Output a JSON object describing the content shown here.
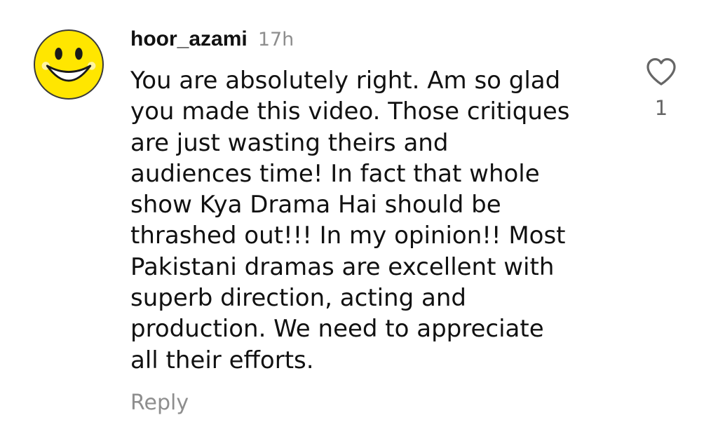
{
  "comment": {
    "username": "hoor_azami",
    "timestamp": "17h",
    "text_lines": [
      "You are absolutely right. Am so glad",
      "you made this video. Those critiques",
      "are just wasting theirs and",
      "audiences time! In fact that whole",
      "show Kya Drama Hai should be",
      "thrashed out!!! In my opinion!! Most",
      "Pakistani dramas are excellent with",
      "superb direction, acting and",
      "production. We need to appreciate",
      "all their efforts."
    ],
    "reply_label": "Reply",
    "like_count": "1",
    "avatar_icon": "smiley-face-icon",
    "like_icon": "heart-outline-icon"
  },
  "colors": {
    "avatar_fill": "#ffe600",
    "secondary_text": "#8e8e8e",
    "primary_text": "#111111"
  }
}
